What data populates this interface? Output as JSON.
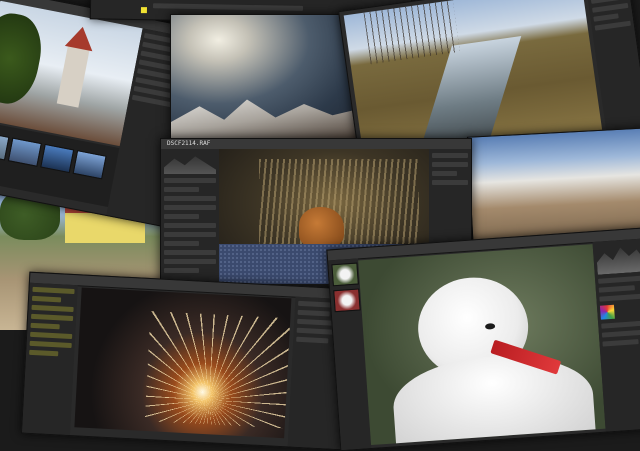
{
  "windows": {
    "main_editor": {
      "filename": "DSCF2114.RAF"
    }
  },
  "icons": {
    "search": "search-icon",
    "close": "close-icon",
    "gear": "gear-icon",
    "histogram": "histogram-icon",
    "color_picker": "color-picker-icon"
  },
  "colors": {
    "panel": "#2a2a2a",
    "titlebar": "#383838",
    "highlight": "#f1e232",
    "background": "#1b1b1b"
  }
}
